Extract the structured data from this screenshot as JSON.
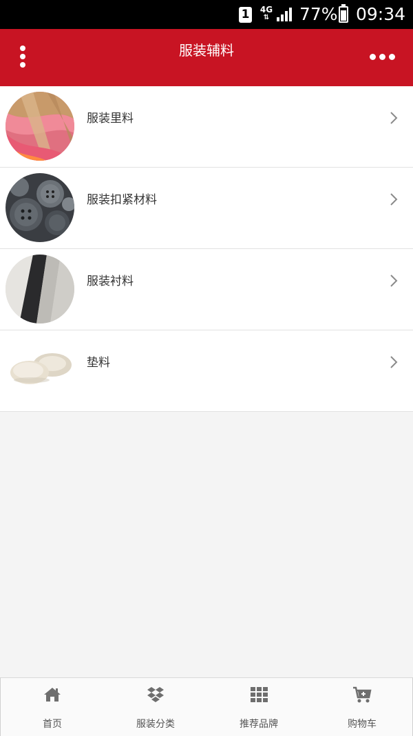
{
  "status_bar": {
    "sim": "1",
    "network": "4G",
    "battery": "77%",
    "battery_level": 0.77,
    "time": "09:34"
  },
  "app_bar": {
    "title": "服装辅料",
    "menu_icon": "vertical-dots-icon",
    "more_icon": "horizontal-dots-icon"
  },
  "list": {
    "items": [
      {
        "label": "服装里料",
        "image": "fabric-lining-photo"
      },
      {
        "label": "服装扣紧材料",
        "image": "buttons-photo"
      },
      {
        "label": "服装衬料",
        "image": "interlining-fabric-photo"
      },
      {
        "label": "垫料",
        "image": "padding-cups-photo"
      }
    ],
    "chevron_icon": "chevron-right-icon"
  },
  "tab_bar": {
    "tabs": [
      {
        "label": "首页",
        "icon": "home-icon"
      },
      {
        "label": "服装分类",
        "icon": "dropbox-icon"
      },
      {
        "label": "推荐品牌",
        "icon": "grid-icon"
      },
      {
        "label": "购物车",
        "icon": "cart-icon"
      }
    ]
  },
  "colors": {
    "accent": "#c81423",
    "background": "#f4f4f4",
    "tab_icon": "#6e6e6e"
  }
}
